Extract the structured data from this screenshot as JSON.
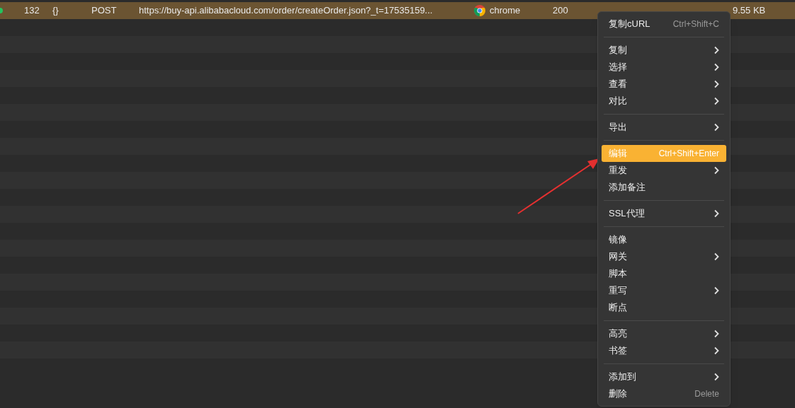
{
  "session_rows": [
    {
      "selected": true,
      "id": "132",
      "type": "{}",
      "method": "POST",
      "url": "https://buy-api.alibabacloud.com/order/createOrder.json?_t=17535159...",
      "client": "chrome",
      "code": "200",
      "size": "9.55 KB"
    }
  ],
  "context_menu": {
    "items": [
      {
        "kind": "item",
        "label": "复制cURL",
        "shortcut": "Ctrl+Shift+C",
        "submenu": false,
        "selected": false
      },
      {
        "kind": "separator"
      },
      {
        "kind": "item",
        "label": "复制",
        "submenu": true,
        "selected": false
      },
      {
        "kind": "item",
        "label": "选择",
        "submenu": true,
        "selected": false
      },
      {
        "kind": "item",
        "label": "查看",
        "submenu": true,
        "selected": false
      },
      {
        "kind": "item",
        "label": "对比",
        "submenu": true,
        "selected": false
      },
      {
        "kind": "separator"
      },
      {
        "kind": "item",
        "label": "导出",
        "submenu": true,
        "selected": false
      },
      {
        "kind": "separator"
      },
      {
        "kind": "item",
        "label": "编辑",
        "shortcut": "Ctrl+Shift+Enter",
        "submenu": false,
        "selected": true
      },
      {
        "kind": "item",
        "label": "重发",
        "submenu": true,
        "selected": false
      },
      {
        "kind": "item",
        "label": "添加备注",
        "submenu": false,
        "selected": false
      },
      {
        "kind": "separator"
      },
      {
        "kind": "item",
        "label": "SSL代理",
        "submenu": true,
        "selected": false
      },
      {
        "kind": "separator"
      },
      {
        "kind": "item",
        "label": "镜像",
        "submenu": false,
        "selected": false
      },
      {
        "kind": "item",
        "label": "网关",
        "submenu": true,
        "selected": false
      },
      {
        "kind": "item",
        "label": "脚本",
        "submenu": false,
        "selected": false
      },
      {
        "kind": "item",
        "label": "重写",
        "submenu": true,
        "selected": false
      },
      {
        "kind": "item",
        "label": "断点",
        "submenu": false,
        "selected": false
      },
      {
        "kind": "separator"
      },
      {
        "kind": "item",
        "label": "高亮",
        "submenu": true,
        "selected": false
      },
      {
        "kind": "item",
        "label": "书签",
        "submenu": true,
        "selected": false
      },
      {
        "kind": "separator"
      },
      {
        "kind": "item",
        "label": "添加到",
        "submenu": true,
        "selected": false
      },
      {
        "kind": "item",
        "label": "删除",
        "shortcut": "Delete",
        "submenu": false,
        "selected": false
      }
    ]
  }
}
